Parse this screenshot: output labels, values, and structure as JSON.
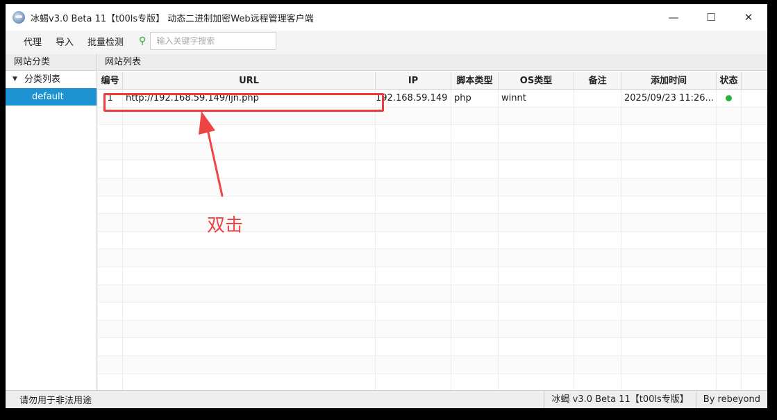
{
  "window": {
    "title": "冰蝎v3.0 Beta 11【t00ls专版】 动态二进制加密Web远程管理客户端",
    "minimize_glyph": "—",
    "maximize_glyph": "☐",
    "close_glyph": "✕"
  },
  "toolbar": {
    "proxy": "代理",
    "import": "导入",
    "batch_check": "批量检测",
    "search_placeholder": "输入关键字搜索"
  },
  "sidebar": {
    "header": "网站分类",
    "root_label": "分类列表",
    "items": [
      {
        "label": "default",
        "selected": true
      }
    ]
  },
  "main": {
    "header": "网站列表",
    "columns": [
      "编号",
      "URL",
      "IP",
      "脚本类型",
      "OS类型",
      "备注",
      "添加时间",
      "状态"
    ],
    "rows": [
      {
        "num": "1",
        "url": "http://192.168.59.149/ljn.php",
        "ip": "192.168.59.149",
        "script": "php",
        "os": "winnt",
        "note": "",
        "time": "2025/09/23 11:26...",
        "status": "online"
      }
    ]
  },
  "annotation": {
    "label": "双击",
    "color": "#ee4444"
  },
  "statusbar": {
    "left": "请勿用于非法用途",
    "version": "冰蝎 v3.0 Beta 11【t00ls专版】",
    "author": "By rebeyond"
  },
  "colors": {
    "selection": "#1d93d1",
    "status_online": "#27b33c",
    "highlight": "#ee3b3b"
  }
}
